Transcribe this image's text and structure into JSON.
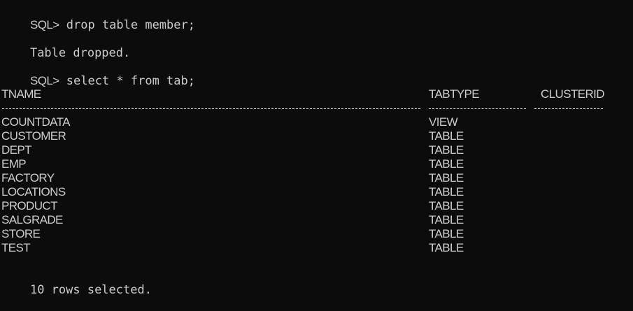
{
  "terminal": {
    "prompt": "SQL>",
    "command_1": "drop table member;",
    "result_1": "Table dropped.",
    "command_2": "select * from tab;",
    "columns": {
      "tname": "TNAME",
      "tabtype": "TABTYPE",
      "clusterid": "CLUSTERID"
    },
    "rows": [
      {
        "tname": "COUNTDATA",
        "tabtype": "VIEW",
        "clusterid": ""
      },
      {
        "tname": "CUSTOMER",
        "tabtype": "TABLE",
        "clusterid": ""
      },
      {
        "tname": "DEPT",
        "tabtype": "TABLE",
        "clusterid": ""
      },
      {
        "tname": "EMP",
        "tabtype": "TABLE",
        "clusterid": ""
      },
      {
        "tname": "FACTORY",
        "tabtype": "TABLE",
        "clusterid": ""
      },
      {
        "tname": "LOCATIONS",
        "tabtype": "TABLE",
        "clusterid": ""
      },
      {
        "tname": "PRODUCT",
        "tabtype": "TABLE",
        "clusterid": ""
      },
      {
        "tname": "SALGRADE",
        "tabtype": "TABLE",
        "clusterid": ""
      },
      {
        "tname": "STORE",
        "tabtype": "TABLE",
        "clusterid": ""
      },
      {
        "tname": "TEST",
        "tabtype": "TABLE",
        "clusterid": ""
      }
    ],
    "summary": "10 rows selected.",
    "colors": {
      "background": "#0c0c0c",
      "foreground": "#cccccc"
    }
  }
}
